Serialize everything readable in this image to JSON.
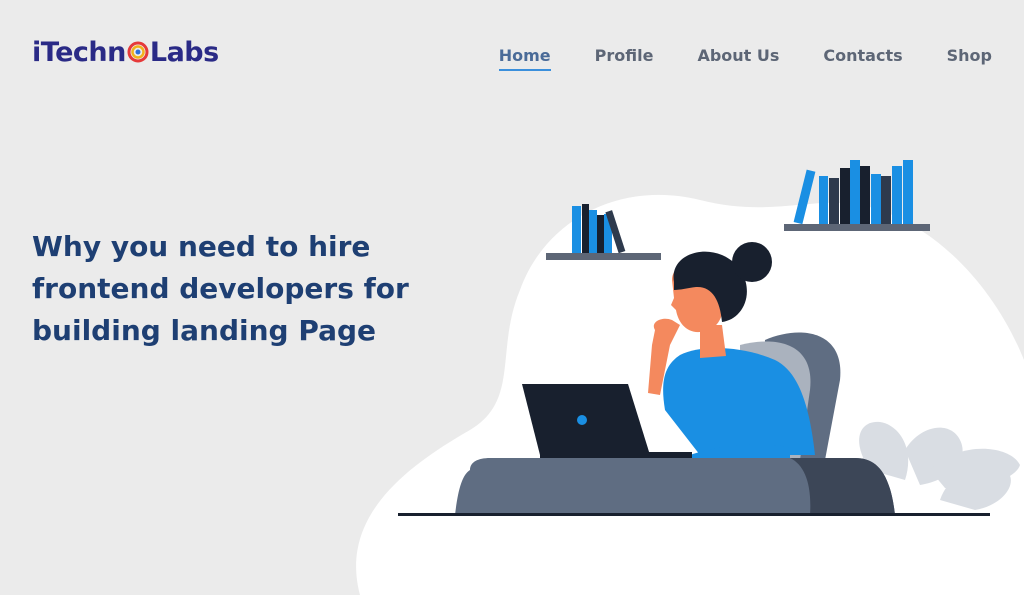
{
  "brand": {
    "logo_prefix": "iTechn",
    "logo_suffix": "Labs"
  },
  "nav": {
    "items": [
      {
        "label": "Home",
        "active": true
      },
      {
        "label": "Profile",
        "active": false
      },
      {
        "label": "About Us",
        "active": false
      },
      {
        "label": "Contacts",
        "active": false
      },
      {
        "label": "Shop",
        "active": false
      }
    ]
  },
  "hero": {
    "headline": "Why you need to hire frontend developers for building landing Page"
  },
  "colors": {
    "background": "#ebebeb",
    "headline": "#1e3f73",
    "nav_text": "#5d6676",
    "nav_active_underline": "#3a8fdc",
    "accent_blue": "#1a8fe3",
    "dark_navy": "#18202e"
  },
  "icons": {
    "logo_ring": "logo-ring-icon",
    "person_illustration": "woman-at-laptop-illustration",
    "bookshelf": "bookshelf-icon",
    "plant": "leaf-plant-icon"
  }
}
